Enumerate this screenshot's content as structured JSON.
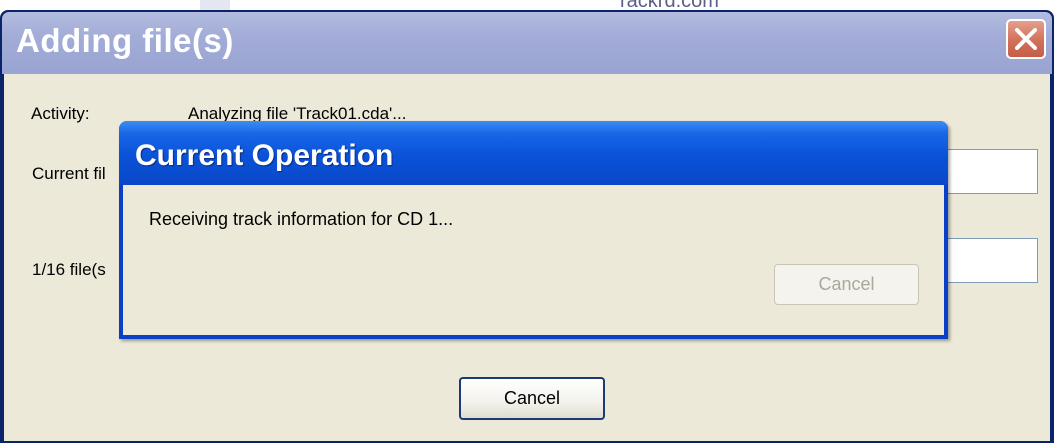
{
  "background": {
    "url_fragment": "rackrd.com"
  },
  "main_window": {
    "title": "Adding file(s)",
    "activity_label": "Activity:",
    "activity_value": "Analyzing file 'Track01.cda'...",
    "current_file_label": "Current fil",
    "files_progress_label": "1/16 file(s",
    "cancel_label": "Cancel"
  },
  "overlay_dialog": {
    "title": "Current Operation",
    "message": "Receiving track information for CD 1...",
    "cancel_label": "Cancel"
  },
  "colors": {
    "main_titlebar": "#a2acd7",
    "overlay_titlebar": "#0a52d8",
    "window_face": "#ece9d8",
    "close_button": "#d2705a"
  }
}
